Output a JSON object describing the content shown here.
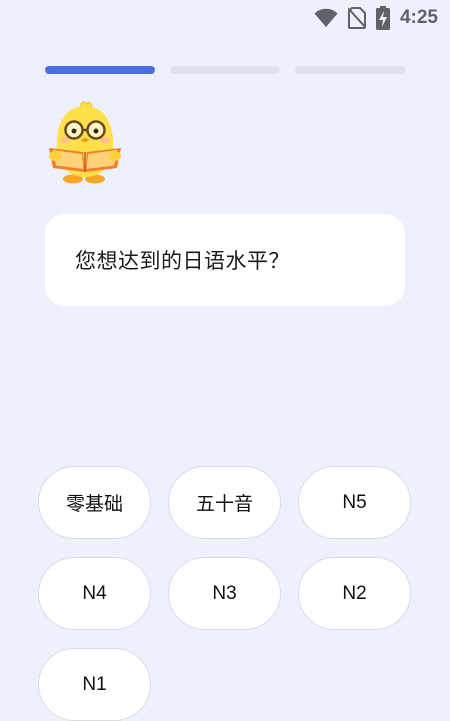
{
  "status_bar": {
    "time": "4:25",
    "icons": [
      "wifi-icon",
      "no-sim-icon",
      "battery-charging-icon"
    ]
  },
  "progress": {
    "total_steps": 3,
    "current_step": 1
  },
  "mascot": {
    "icon": "chick-reading-book-icon"
  },
  "question": {
    "text": "您想达到的日语水平？"
  },
  "options": [
    {
      "label": "零基础"
    },
    {
      "label": "五十音"
    },
    {
      "label": "N5"
    },
    {
      "label": "N4"
    },
    {
      "label": "N3"
    },
    {
      "label": "N2"
    },
    {
      "label": "N1"
    }
  ],
  "colors": {
    "background": "#eef1fd",
    "progress_active": "#4d6ce0",
    "progress_inactive": "#dfe3ee",
    "card": "#ffffff"
  }
}
